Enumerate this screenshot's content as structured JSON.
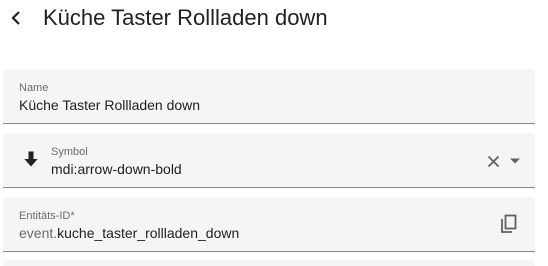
{
  "header": {
    "back_icon": "chevron-left-icon",
    "title": "Küche Taster Rollladen down"
  },
  "form": {
    "name": {
      "label": "Name",
      "value": "Küche Taster Rollladen down"
    },
    "symbol": {
      "label": "Symbol",
      "value": "mdi:arrow-down-bold",
      "leading_icon": "arrow-down-bold-icon",
      "clear_icon": "close-icon",
      "dropdown_icon": "menu-down-icon"
    },
    "entity_id": {
      "label": "Entitäts-ID*",
      "prefix": "event.",
      "value": "kuche_taster_rollladen_down",
      "copy_icon": "content-copy-icon"
    }
  },
  "colors": {
    "field_background": "#f5f5f5",
    "text_primary": "#212121",
    "text_secondary": "#6b6b6b",
    "underline": "#8a8a8a"
  }
}
